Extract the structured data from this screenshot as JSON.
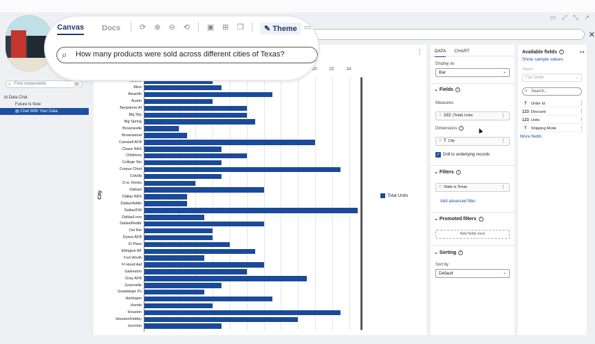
{
  "magnifier": {
    "tabs": [
      {
        "label": "Canvas"
      },
      {
        "label": "Docs"
      }
    ],
    "theme_label": "Theme",
    "question": "How many products were sold across different cities of Texas?"
  },
  "sidebar": {
    "find_placeholder": "Find components",
    "tree": [
      {
        "label": "Data Chat"
      },
      {
        "label": "Future Is Now"
      },
      {
        "label": "Chat With Your Data"
      }
    ]
  },
  "chart_data": {
    "type": "bar",
    "orientation": "horizontal",
    "ylabel": "City",
    "x_ticks": [
      "20",
      "22",
      "24"
    ],
    "legend": "Total Units",
    "categories": [
      "Abilene",
      "Alice",
      "Amarillo",
      "Austin",
      "Bergstrom Af",
      "Big Sky",
      "Big Spring",
      "Brownsville",
      "Brownwood",
      "Carswell AFB",
      "Chase NAS",
      "Childress",
      "College Stn",
      "Corpus Chrst",
      "Cotulla",
      "D.w. Hooks",
      "Dalhart",
      "Dallas NAS",
      "Dallas/Addis",
      "Dallas/FW",
      "Dallas/Love",
      "Dallas/Redbr",
      "Del Rio",
      "Dyess AFB",
      "El Paso",
      "Ellington AF",
      "Fort Worth",
      "Ft Hood Aaf",
      "Galveston",
      "Gray AFB",
      "Greenville",
      "Guadalupe Ps",
      "Harlingen",
      "Hondo",
      "Houston",
      "Houston/Hobby",
      "Junction"
    ],
    "values": [
      8,
      9,
      15,
      8,
      12,
      12,
      13,
      4,
      5,
      20,
      9,
      12,
      9,
      23,
      9,
      6,
      14,
      5,
      5,
      25,
      7,
      14,
      8,
      8,
      10,
      13,
      7,
      14,
      12,
      19,
      9,
      7,
      15,
      8,
      23,
      18,
      9
    ]
  },
  "config": {
    "tabs": [
      "DATA",
      "CHART"
    ],
    "display_as_label": "Display as",
    "display_as_value": "Bar",
    "fields_heading": "Fields",
    "measures_label": "Measures",
    "measure_type": "123",
    "measure_value": "(Total) Units",
    "dimensions_label": "Dimensions",
    "dimension_type": "T",
    "dimension_value": "City",
    "drill_label": "Drill to underlying records",
    "filters_heading": "Filters",
    "filter_value": "State is Texas",
    "add_filter_link": "Add advanced filter",
    "promoted_heading": "Promoted filters",
    "add_fields_here": "Add fields here",
    "sorting_heading": "Sorting",
    "sort_by_label": "Sort by",
    "sort_by_value": "Default"
  },
  "available": {
    "title": "Available fields",
    "show_sample": "Show sample values",
    "object_label": "Object",
    "object_value": "Flat Order",
    "search_placeholder": "Search...",
    "fields": [
      {
        "type": "T",
        "name": "Order Id"
      },
      {
        "type": "123",
        "name": "Discount"
      },
      {
        "type": "123",
        "name": "Units"
      },
      {
        "type": "T",
        "name": "Shipping Mode"
      }
    ],
    "more_fields": "More fields"
  }
}
